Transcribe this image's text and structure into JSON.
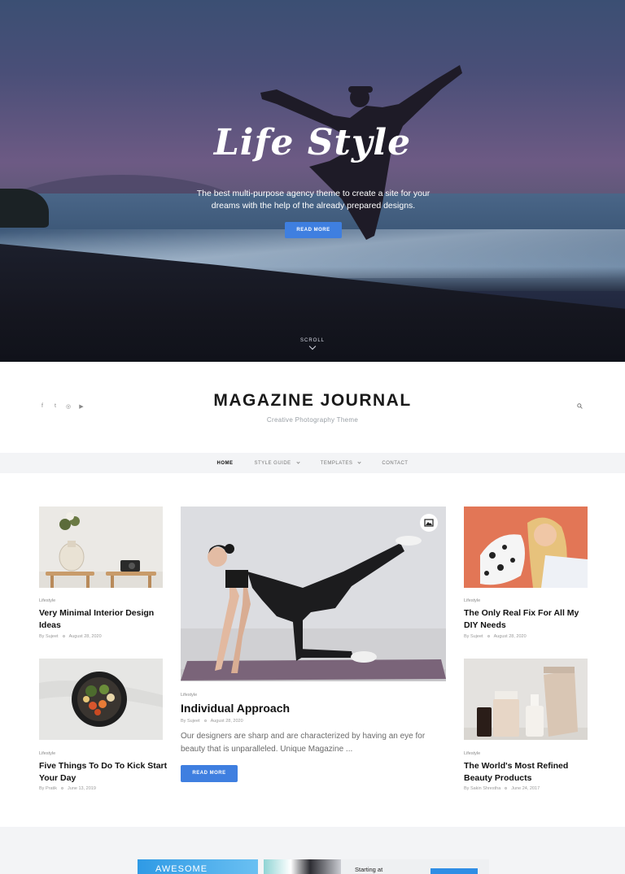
{
  "hero": {
    "title": "Life Style",
    "subtitle": "The best multi-purpose agency theme to create a site for your dreams with the help of the already prepared designs.",
    "button_label": "READ MORE",
    "scroll_label": "SCROLL"
  },
  "header": {
    "social_icons": [
      "facebook-icon",
      "twitter-icon",
      "instagram-icon",
      "youtube-icon"
    ],
    "social_glyphs": [
      "f",
      "t",
      "◎",
      "▶"
    ],
    "site_title": "MAGAZINE JOURNAL",
    "tagline": "Creative Photography Theme"
  },
  "nav": {
    "items": [
      {
        "label": "HOME",
        "active": true
      },
      {
        "label": "STYLE GUIDE",
        "dropdown": true
      },
      {
        "label": "TEMPLATES",
        "dropdown": true
      },
      {
        "label": "CONTACT"
      }
    ]
  },
  "posts": {
    "left": [
      {
        "category": "Lifestyle",
        "title": "Very Minimal Interior Design Ideas",
        "by": "By",
        "author": "Sujeet",
        "date": "August 28, 2020"
      },
      {
        "category": "Lifestyle",
        "title": "Five Things To Do To Kick Start Your Day",
        "by": "By",
        "author": "Pratik",
        "date": "June 13, 2019"
      }
    ],
    "featured": {
      "category": "Lifestyle",
      "title": "Individual Approach",
      "by": "By",
      "author": "Sujeet",
      "date": "August 28, 2020",
      "excerpt": "Our designers are sharp and are characterized by having an eye for beauty that is unparalleled. Unique Magazine ...",
      "button_label": "READ MORE"
    },
    "right": [
      {
        "category": "Lifestyle",
        "title": "The Only Real Fix For All My DIY Needs",
        "by": "By",
        "author": "Sujeet",
        "date": "August 28, 2020"
      },
      {
        "category": "Lifestyle",
        "title": "The World's Most Refined Beauty Products",
        "by": "By",
        "author": "Sakin Shrestha",
        "date": "June 24, 2017"
      }
    ]
  },
  "bottom": {
    "ad1_text": "AWESOME",
    "ad2_text": "Starting at"
  },
  "colors": {
    "accent": "#3f7fe0",
    "title": "#111111",
    "muted": "#9a9a9a"
  }
}
